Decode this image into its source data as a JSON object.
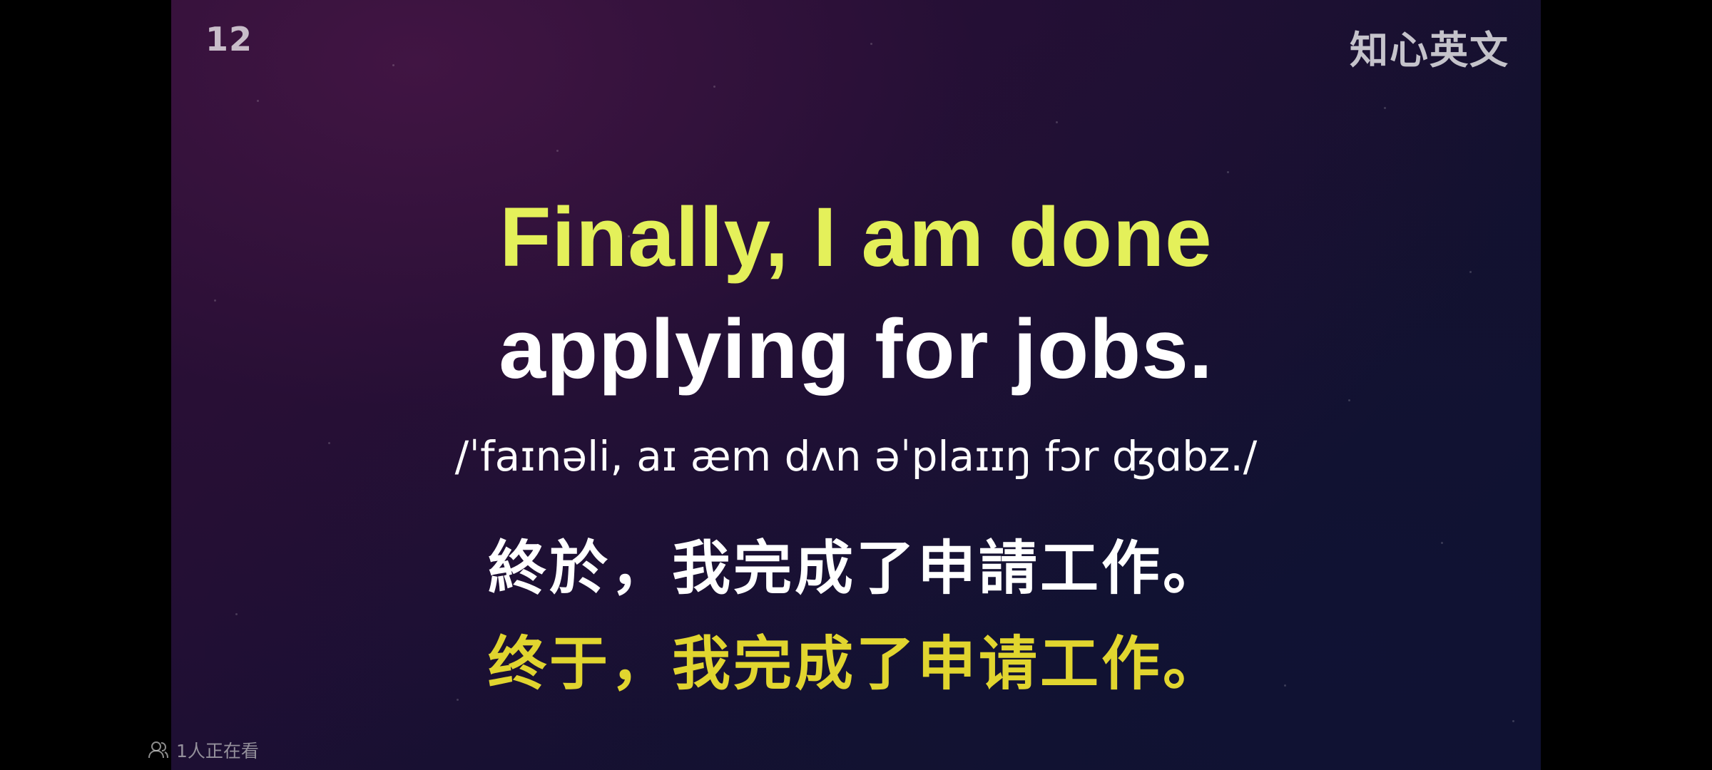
{
  "video": {
    "episode_number": "12",
    "channel_logo": "知心英文",
    "subtitles": {
      "english_line_1": "Finally, I am done",
      "english_line_2": "applying for jobs.",
      "phonetic": "/ˈfaɪnəli, aɪ æm dʌn əˈplaɪɪŋ fɔr ʤɑbz./",
      "traditional_chinese": "終於，我完成了申請工作。",
      "simplified_chinese": "终于，我完成了申请工作。"
    }
  },
  "overlay": {
    "viewer_icon": "viewers-icon",
    "viewer_count_text": "1人正在看"
  },
  "colors": {
    "english_highlight": "#e4f05a",
    "simplified_highlight": "#e1d52f",
    "text_white": "#ffffff",
    "letterbox": "#000000"
  }
}
